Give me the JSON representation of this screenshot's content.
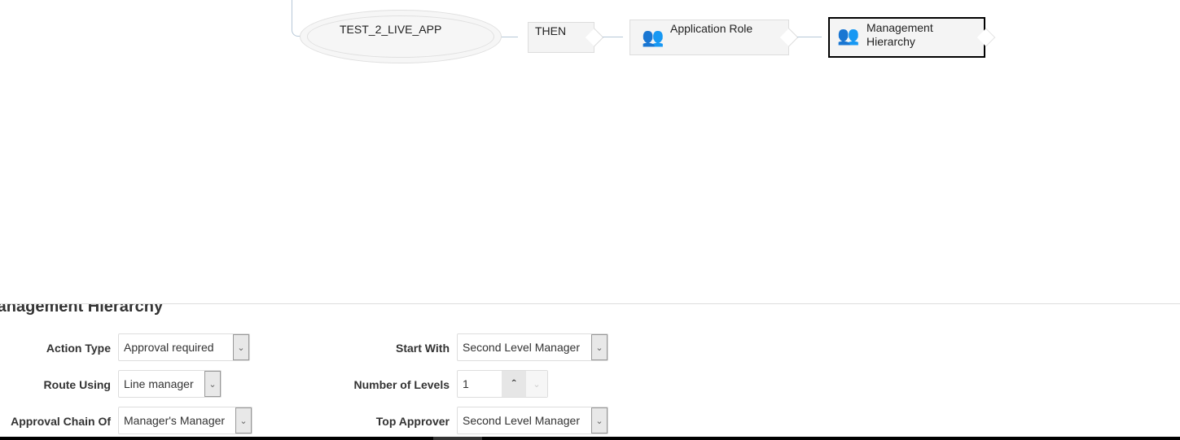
{
  "diagram": {
    "nodes": [
      {
        "label": "TEST_2_LIVE_APP"
      },
      {
        "label": "THEN"
      },
      {
        "label": "Application Role",
        "icon": "users-group-icon"
      },
      {
        "label_line1": "Management",
        "label_line2": "Hierarchy",
        "icon": "management-hierarchy-icon",
        "selected": true
      }
    ]
  },
  "panel": {
    "title": "Management Hierarchy",
    "fields": {
      "action_type": {
        "label": "Action Type",
        "value": "Approval required"
      },
      "route_using": {
        "label": "Route Using",
        "value": "Line manager"
      },
      "approval_chain_of": {
        "label": "Approval Chain Of",
        "value": "Manager's Manager"
      },
      "start_with": {
        "label": "Start With",
        "value": "Second Level Manager"
      },
      "number_of_levels": {
        "label": "Number of Levels",
        "value": "1"
      },
      "top_approver": {
        "label": "Top Approver",
        "value": "Second Level Manager"
      }
    }
  }
}
